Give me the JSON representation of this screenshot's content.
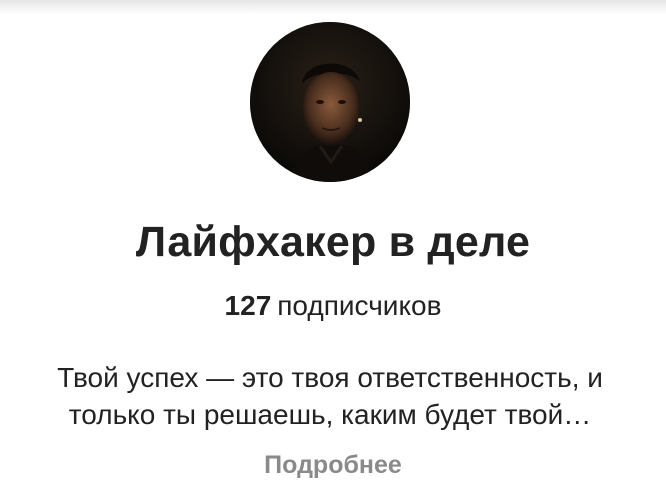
{
  "channel": {
    "avatar_alt": "channel-avatar",
    "title": "Лайфхакер в деле",
    "subscriber_count": "127",
    "subscriber_label": "подписчиков",
    "description_line1": "Твой успех — это твоя ответственность, и",
    "description_line2": "только ты решаешь, каким будет твой…",
    "more_label": "Подробнее"
  },
  "colors": {
    "text": "#222222",
    "muted": "#8a8a8a",
    "background": "#ffffff"
  }
}
